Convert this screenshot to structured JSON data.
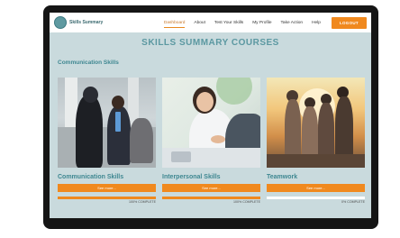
{
  "app": {
    "logo_text": "Skills Summary"
  },
  "nav": {
    "items": [
      {
        "label": "Dashboard",
        "active": true
      },
      {
        "label": "About",
        "active": false
      },
      {
        "label": "Test Your Skills",
        "active": false
      },
      {
        "label": "My Profile",
        "active": false
      },
      {
        "label": "Take Action",
        "active": false
      },
      {
        "label": "Help",
        "active": false
      }
    ],
    "logout_label": "LOGOUT"
  },
  "page": {
    "title": "SKILLS SUMMARY COURSES",
    "section_heading": "Communication Skills"
  },
  "courses": [
    {
      "title": "Communication Skills",
      "button_label": "See more...",
      "progress_text": "100% COMPLETE",
      "progress_fraction": 1.0,
      "image_icon": "students-photo"
    },
    {
      "title": "Interpersonal Skills",
      "button_label": "See more...",
      "progress_text": "100% COMPLETE",
      "progress_fraction": 1.0,
      "image_icon": "handshake-photo"
    },
    {
      "title": "Teamwork",
      "button_label": "See more...",
      "progress_text": "0% COMPLETE",
      "progress_fraction": 0.0,
      "image_icon": "team-sunset-photo"
    }
  ],
  "colors": {
    "accent": "#f0891e",
    "heading": "#3e8791",
    "background": "#c9dadd"
  }
}
